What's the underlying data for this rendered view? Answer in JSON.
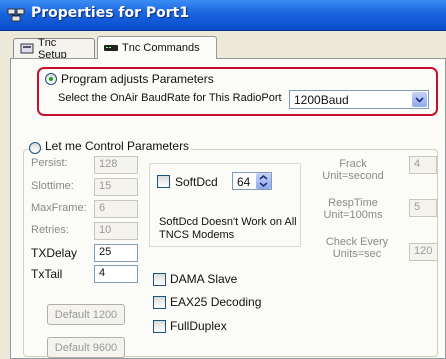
{
  "window": {
    "title": "Properties for Port1"
  },
  "tabs": [
    {
      "label": "Tnc Setup",
      "active": false
    },
    {
      "label": "Tnc Commands",
      "active": true
    }
  ],
  "program_adjusts": {
    "label": "Program adjusts Parameters",
    "selected": true,
    "baud_label": "Select the OnAir BaudRate for This RadioPort",
    "baud_value": "1200Baud"
  },
  "let_me_control": {
    "label": "Let me Control Parameters",
    "selected": false
  },
  "params": {
    "persist": {
      "label": "Persist:",
      "value": "128"
    },
    "slottime": {
      "label": "Slottime:",
      "value": "15"
    },
    "maxframe": {
      "label": "MaxFrame:",
      "value": "6"
    },
    "retries": {
      "label": "Retries:",
      "value": "10"
    },
    "txdelay": {
      "label": "TXDelay",
      "value": "25"
    },
    "txtail": {
      "label": "TxTail",
      "value": "4"
    }
  },
  "softdcd": {
    "label": "SoftDcd",
    "value": "64",
    "note_line1": "SoftDcd Doesn't Work on All",
    "note_line2": "TNCS  Modems"
  },
  "options": {
    "dama": "DAMA Slave",
    "eax25": "EAX25 Decoding",
    "fullduplex": "FullDuplex"
  },
  "right": {
    "frack_line1": "Frack",
    "frack_line2": "Unit=second",
    "frack_value": "4",
    "resp_line1": "RespTime",
    "resp_line2": "Unit=100ms",
    "resp_value": "5",
    "check_line1": "Check Every",
    "check_line2": "Units=sec",
    "check_value": "120"
  },
  "buttons": {
    "default1200": "Default 1200",
    "default9600": "Default 9600"
  },
  "colors": {
    "title_bar": "#1a64de",
    "highlight": "#c8102e",
    "radio_dot": "#22a01c"
  }
}
